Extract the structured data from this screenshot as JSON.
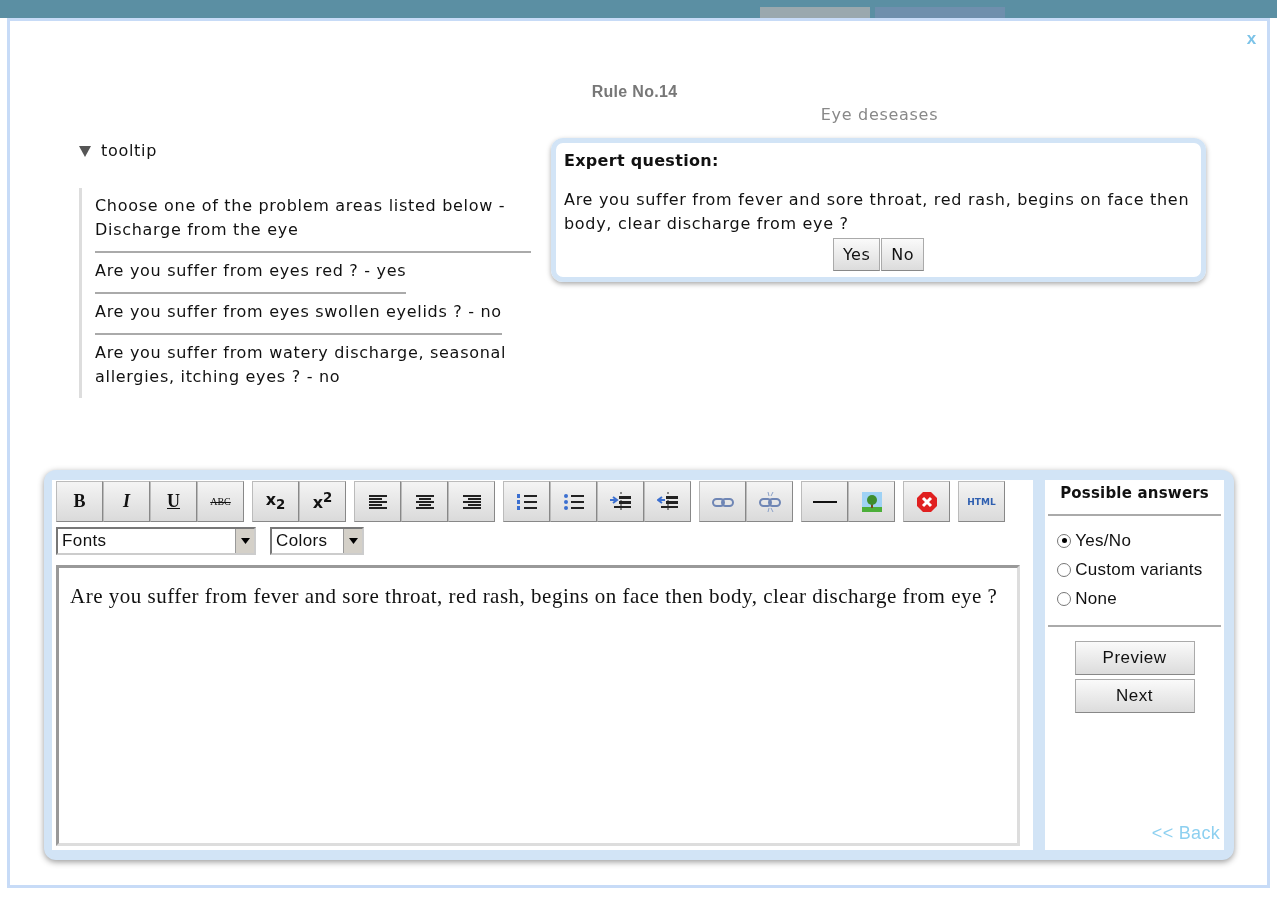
{
  "background_tabs": [
    {
      "kind": "user"
    },
    {
      "kind": "expert"
    }
  ],
  "dialog": {
    "close": "x",
    "title": "Rule No.14",
    "subtitle": "Eye deseases"
  },
  "tooltip": {
    "label": "tooltip",
    "expanded": true,
    "items": [
      {
        "text": "Choose one of the problem areas listed below - Discharge from the eye"
      },
      {
        "text": "Are you suffer from eyes red ? - yes"
      },
      {
        "text": "Are you suffer from eyes swollen eyelids ? - no"
      },
      {
        "text": "Are you suffer from watery discharge, seasonal allergies, itching eyes ? - no"
      }
    ]
  },
  "expert_question": {
    "heading": "Expert question:",
    "text": "Are you suffer from fever and sore throat, red rash, begins on face then body, clear discharge from eye ?",
    "buttons": [
      "Yes",
      "No"
    ]
  },
  "toolbar": {
    "groups": [
      [
        {
          "kind": "bold",
          "glyph": "B"
        },
        {
          "kind": "italic",
          "glyph": "I"
        },
        {
          "kind": "underline",
          "glyph": "U"
        },
        {
          "kind": "strike",
          "glyph": "ABC"
        }
      ],
      [
        {
          "kind": "subscript",
          "glyph": "x$_{2}$"
        },
        {
          "kind": "superscript",
          "glyph": "x$^{2}$"
        }
      ],
      [
        {
          "kind": "align-left"
        },
        {
          "kind": "align-center"
        },
        {
          "kind": "align-right"
        }
      ],
      [
        {
          "kind": "ordered-list"
        },
        {
          "kind": "bullet-list"
        },
        {
          "kind": "indent"
        },
        {
          "kind": "outdent"
        }
      ],
      [
        {
          "kind": "link"
        },
        {
          "kind": "unlink"
        }
      ],
      [
        {
          "kind": "rule"
        },
        {
          "kind": "image"
        }
      ],
      [
        {
          "kind": "remove"
        }
      ],
      [
        {
          "kind": "html",
          "glyph": "HTML"
        }
      ]
    ]
  },
  "selects": [
    {
      "kind": "fonts",
      "value": "Fonts"
    },
    {
      "kind": "colors",
      "value": "Colors"
    }
  ],
  "editor": {
    "text": "Are you suffer from fever and sore throat, red rash, begins on face then body, clear discharge from eye ?"
  },
  "answers": {
    "heading": "Possible answers",
    "options": [
      {
        "label": "Yes/No",
        "selected": true
      },
      {
        "label": "Custom variants",
        "selected": false
      },
      {
        "label": "None",
        "selected": false
      }
    ],
    "buttons": [
      "Preview",
      "Next"
    ],
    "back": "<< Back"
  }
}
